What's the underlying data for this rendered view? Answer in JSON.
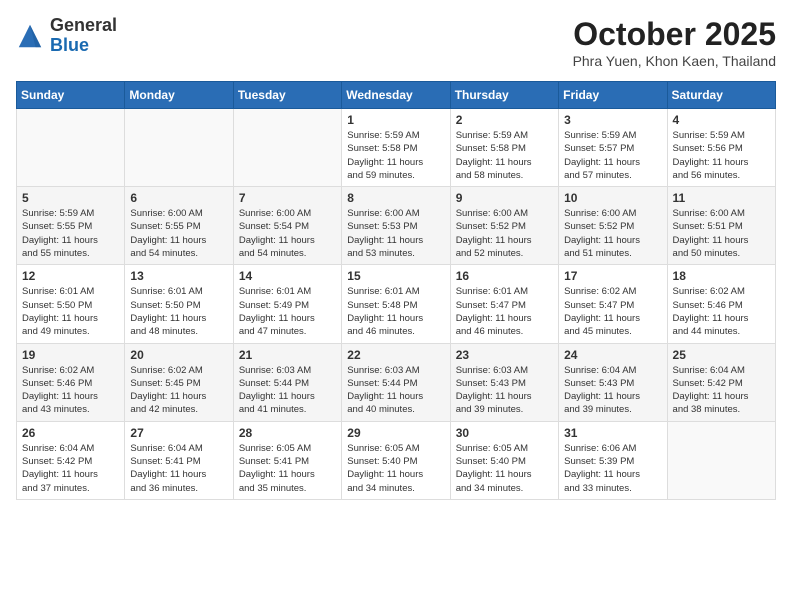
{
  "header": {
    "logo_line1": "General",
    "logo_line2": "Blue",
    "month": "October 2025",
    "location": "Phra Yuen, Khon Kaen, Thailand"
  },
  "weekdays": [
    "Sunday",
    "Monday",
    "Tuesday",
    "Wednesday",
    "Thursday",
    "Friday",
    "Saturday"
  ],
  "weeks": [
    [
      {
        "day": "",
        "info": ""
      },
      {
        "day": "",
        "info": ""
      },
      {
        "day": "",
        "info": ""
      },
      {
        "day": "1",
        "info": "Sunrise: 5:59 AM\nSunset: 5:58 PM\nDaylight: 11 hours\nand 59 minutes."
      },
      {
        "day": "2",
        "info": "Sunrise: 5:59 AM\nSunset: 5:58 PM\nDaylight: 11 hours\nand 58 minutes."
      },
      {
        "day": "3",
        "info": "Sunrise: 5:59 AM\nSunset: 5:57 PM\nDaylight: 11 hours\nand 57 minutes."
      },
      {
        "day": "4",
        "info": "Sunrise: 5:59 AM\nSunset: 5:56 PM\nDaylight: 11 hours\nand 56 minutes."
      }
    ],
    [
      {
        "day": "5",
        "info": "Sunrise: 5:59 AM\nSunset: 5:55 PM\nDaylight: 11 hours\nand 55 minutes."
      },
      {
        "day": "6",
        "info": "Sunrise: 6:00 AM\nSunset: 5:55 PM\nDaylight: 11 hours\nand 54 minutes."
      },
      {
        "day": "7",
        "info": "Sunrise: 6:00 AM\nSunset: 5:54 PM\nDaylight: 11 hours\nand 54 minutes."
      },
      {
        "day": "8",
        "info": "Sunrise: 6:00 AM\nSunset: 5:53 PM\nDaylight: 11 hours\nand 53 minutes."
      },
      {
        "day": "9",
        "info": "Sunrise: 6:00 AM\nSunset: 5:52 PM\nDaylight: 11 hours\nand 52 minutes."
      },
      {
        "day": "10",
        "info": "Sunrise: 6:00 AM\nSunset: 5:52 PM\nDaylight: 11 hours\nand 51 minutes."
      },
      {
        "day": "11",
        "info": "Sunrise: 6:00 AM\nSunset: 5:51 PM\nDaylight: 11 hours\nand 50 minutes."
      }
    ],
    [
      {
        "day": "12",
        "info": "Sunrise: 6:01 AM\nSunset: 5:50 PM\nDaylight: 11 hours\nand 49 minutes."
      },
      {
        "day": "13",
        "info": "Sunrise: 6:01 AM\nSunset: 5:50 PM\nDaylight: 11 hours\nand 48 minutes."
      },
      {
        "day": "14",
        "info": "Sunrise: 6:01 AM\nSunset: 5:49 PM\nDaylight: 11 hours\nand 47 minutes."
      },
      {
        "day": "15",
        "info": "Sunrise: 6:01 AM\nSunset: 5:48 PM\nDaylight: 11 hours\nand 46 minutes."
      },
      {
        "day": "16",
        "info": "Sunrise: 6:01 AM\nSunset: 5:47 PM\nDaylight: 11 hours\nand 46 minutes."
      },
      {
        "day": "17",
        "info": "Sunrise: 6:02 AM\nSunset: 5:47 PM\nDaylight: 11 hours\nand 45 minutes."
      },
      {
        "day": "18",
        "info": "Sunrise: 6:02 AM\nSunset: 5:46 PM\nDaylight: 11 hours\nand 44 minutes."
      }
    ],
    [
      {
        "day": "19",
        "info": "Sunrise: 6:02 AM\nSunset: 5:46 PM\nDaylight: 11 hours\nand 43 minutes."
      },
      {
        "day": "20",
        "info": "Sunrise: 6:02 AM\nSunset: 5:45 PM\nDaylight: 11 hours\nand 42 minutes."
      },
      {
        "day": "21",
        "info": "Sunrise: 6:03 AM\nSunset: 5:44 PM\nDaylight: 11 hours\nand 41 minutes."
      },
      {
        "day": "22",
        "info": "Sunrise: 6:03 AM\nSunset: 5:44 PM\nDaylight: 11 hours\nand 40 minutes."
      },
      {
        "day": "23",
        "info": "Sunrise: 6:03 AM\nSunset: 5:43 PM\nDaylight: 11 hours\nand 39 minutes."
      },
      {
        "day": "24",
        "info": "Sunrise: 6:04 AM\nSunset: 5:43 PM\nDaylight: 11 hours\nand 39 minutes."
      },
      {
        "day": "25",
        "info": "Sunrise: 6:04 AM\nSunset: 5:42 PM\nDaylight: 11 hours\nand 38 minutes."
      }
    ],
    [
      {
        "day": "26",
        "info": "Sunrise: 6:04 AM\nSunset: 5:42 PM\nDaylight: 11 hours\nand 37 minutes."
      },
      {
        "day": "27",
        "info": "Sunrise: 6:04 AM\nSunset: 5:41 PM\nDaylight: 11 hours\nand 36 minutes."
      },
      {
        "day": "28",
        "info": "Sunrise: 6:05 AM\nSunset: 5:41 PM\nDaylight: 11 hours\nand 35 minutes."
      },
      {
        "day": "29",
        "info": "Sunrise: 6:05 AM\nSunset: 5:40 PM\nDaylight: 11 hours\nand 34 minutes."
      },
      {
        "day": "30",
        "info": "Sunrise: 6:05 AM\nSunset: 5:40 PM\nDaylight: 11 hours\nand 34 minutes."
      },
      {
        "day": "31",
        "info": "Sunrise: 6:06 AM\nSunset: 5:39 PM\nDaylight: 11 hours\nand 33 minutes."
      },
      {
        "day": "",
        "info": ""
      }
    ]
  ]
}
